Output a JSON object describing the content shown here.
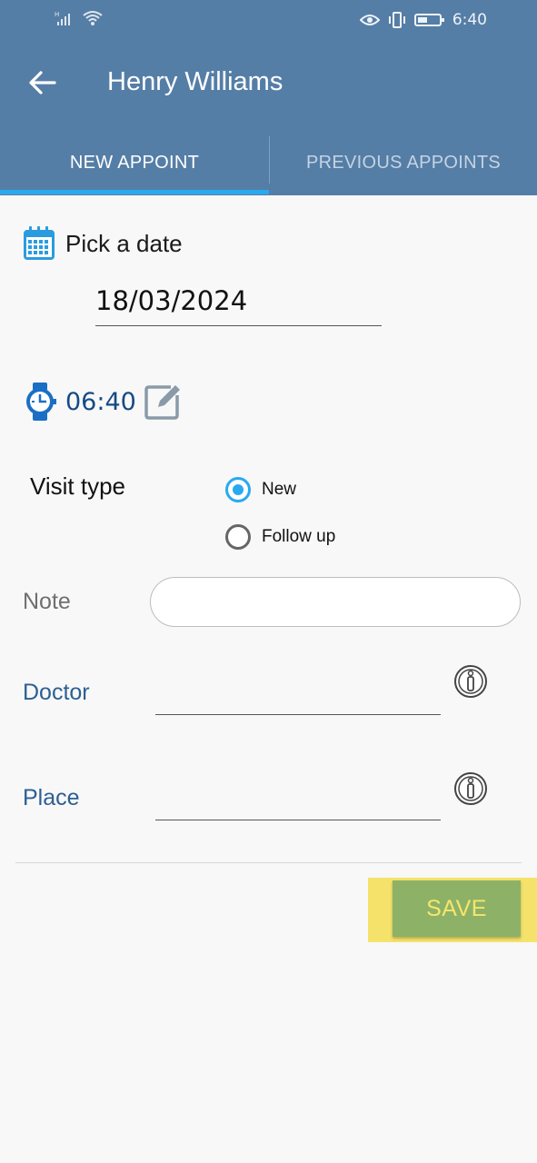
{
  "status_bar": {
    "time": "6:40",
    "icons": [
      "signal-icon",
      "wifi-icon",
      "eye-icon",
      "vibrate-icon",
      "battery-icon"
    ]
  },
  "app_bar": {
    "title": "Henry Williams",
    "back_icon": "arrow-left-icon"
  },
  "tabs": [
    {
      "label": "NEW APPOINT",
      "active": true
    },
    {
      "label": "PREVIOUS APPOINTS",
      "active": false
    }
  ],
  "form": {
    "date_label": "Pick a date",
    "date_value": "18/03/2024",
    "time_value": "06:40",
    "visit_type_label": "Visit type",
    "visit_options": [
      {
        "label": "New",
        "selected": true
      },
      {
        "label": "Follow up",
        "selected": false
      }
    ],
    "note_label": "Note",
    "note_value": "",
    "doctor_label": "Doctor",
    "doctor_value": "",
    "place_label": "Place",
    "place_value": ""
  },
  "actions": {
    "save_label": "SAVE"
  },
  "colors": {
    "primary": "#557ea6",
    "accent": "#29a9f0",
    "save_button": "#8db267",
    "save_text": "#f5e66b",
    "highlight": "#f5e26b"
  }
}
